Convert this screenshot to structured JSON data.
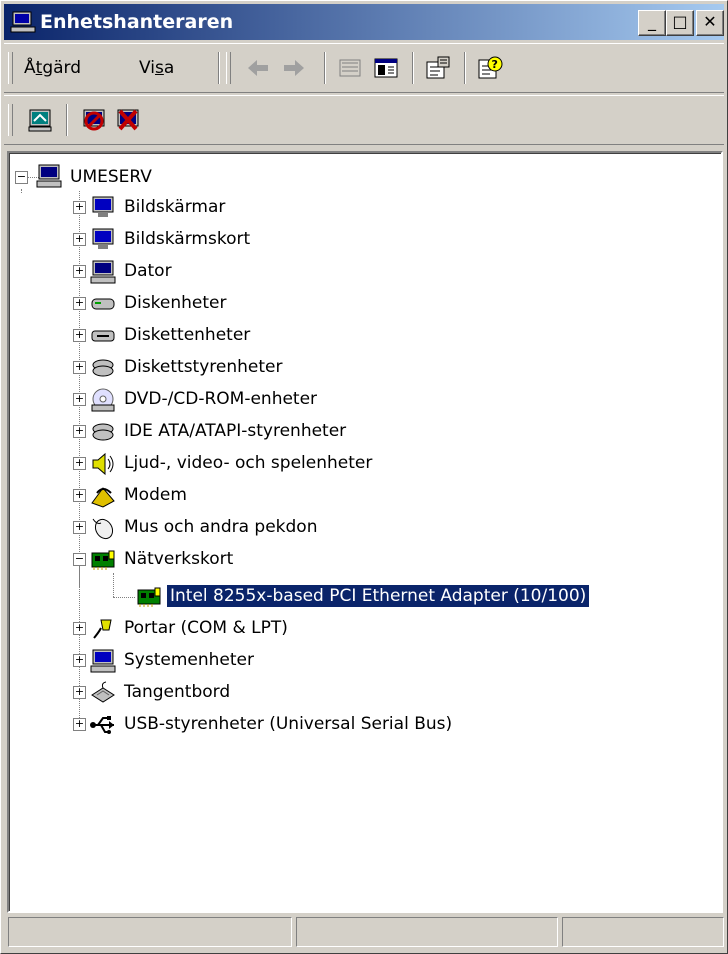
{
  "window": {
    "title": "Enhetshanteraren"
  },
  "caption_buttons": {
    "minimize": "_",
    "maximize": "□",
    "close": "✕"
  },
  "menu": {
    "action_pre": "Å",
    "action_ul": "t",
    "action_post": "gärd",
    "view_pre": "Vi",
    "view_ul": "s",
    "view_post": "a"
  },
  "tree": {
    "root": "UMESERV",
    "categories": [
      {
        "label": "Bildskärmar",
        "icon": "monitor-icon"
      },
      {
        "label": "Bildskärmskort",
        "icon": "display-adapter-icon"
      },
      {
        "label": "Dator",
        "icon": "computer-icon"
      },
      {
        "label": "Diskenheter",
        "icon": "disk-drive-icon"
      },
      {
        "label": "Diskettenheter",
        "icon": "floppy-drive-icon"
      },
      {
        "label": "Diskettstyrenheter",
        "icon": "floppy-controller-icon"
      },
      {
        "label": "DVD-/CD-ROM-enheter",
        "icon": "cdrom-icon"
      },
      {
        "label": "IDE ATA/ATAPI-styrenheter",
        "icon": "ide-controller-icon"
      },
      {
        "label": "Ljud-, video- och spelenheter",
        "icon": "speaker-icon"
      },
      {
        "label": "Modem",
        "icon": "modem-icon"
      },
      {
        "label": "Mus och andra pekdon",
        "icon": "mouse-icon"
      },
      {
        "label": "Nätverkskort",
        "icon": "network-card-icon",
        "expanded": true
      },
      {
        "label": "Portar (COM & LPT)",
        "icon": "port-icon"
      },
      {
        "label": "Systemenheter",
        "icon": "system-device-icon"
      },
      {
        "label": "Tangentbord",
        "icon": "keyboard-icon"
      },
      {
        "label": "USB-styrenheter (Universal Serial Bus)",
        "icon": "usb-icon"
      }
    ],
    "network_child": "Intel 8255x-based PCI Ethernet Adapter (10/100)"
  },
  "colors": {
    "titlebar_start": "#0a246a",
    "titlebar_end": "#a6caf0",
    "selection": "#0a246a",
    "face": "#d4d0c8"
  }
}
